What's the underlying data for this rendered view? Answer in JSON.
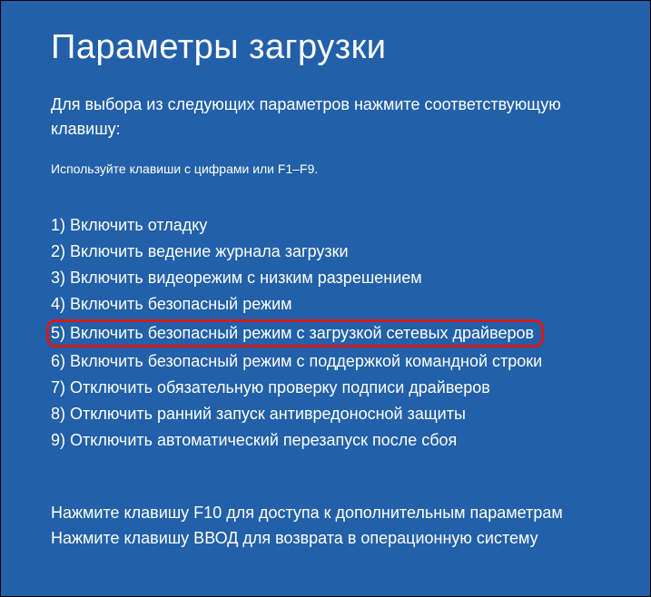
{
  "title": "Параметры загрузки",
  "instruction": "Для выбора из следующих параметров нажмите соответствующую клавишу:",
  "hint": "Используйте клавиши с цифрами или F1–F9.",
  "options": [
    "1) Включить отладку",
    "2) Включить ведение журнала загрузки",
    "3) Включить видеорежим с низким разрешением",
    "4) Включить безопасный режим",
    "5) Включить безопасный режим с загрузкой сетевых драйверов",
    "6) Включить безопасный режим с поддержкой командной строки",
    "7) Отключить обязательную проверку подписи драйверов",
    "8) Отключить ранний запуск антивредоносной защиты",
    "9) Отключить автоматический перезапуск после сбоя"
  ],
  "highlighted_index": 4,
  "footer": {
    "line1": "Нажмите клавишу F10 для доступа к дополнительным параметрам",
    "line2": "Нажмите клавишу ВВОД для возврата в операционную систему"
  }
}
